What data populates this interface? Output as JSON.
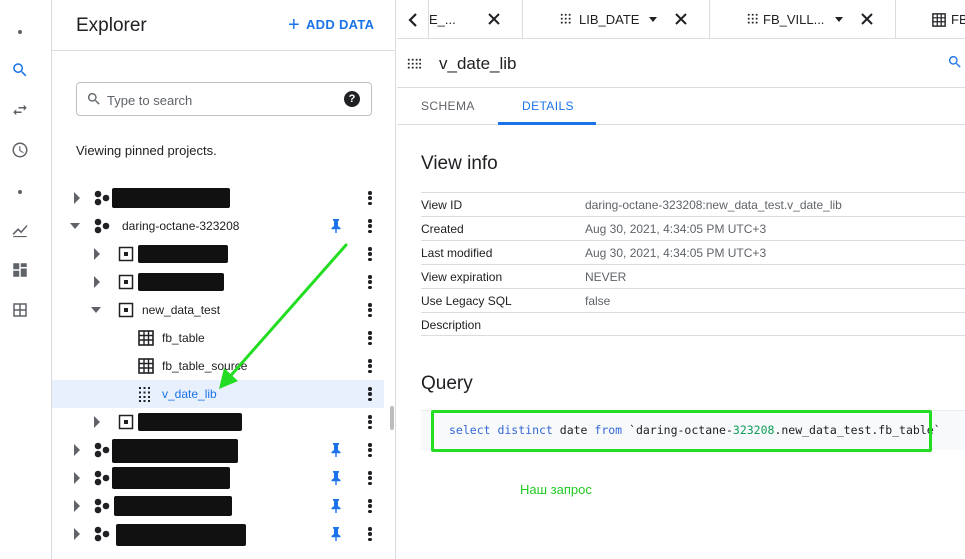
{
  "explorer": {
    "title": "Explorer",
    "add_data_label": "ADD DATA",
    "search_placeholder": "Type to search",
    "pinned_note": "Viewing pinned projects."
  },
  "tree": {
    "project_label": "daring-octane-323208",
    "dataset_label": "new_data_test",
    "items": [
      {
        "label": "fb_table"
      },
      {
        "label": "fb_table_source"
      },
      {
        "label": "v_date_lib"
      }
    ]
  },
  "tabs": [
    {
      "label": "E_...",
      "icon": "table-icon"
    },
    {
      "label": "LIB_DATE",
      "icon": "view-icon"
    },
    {
      "label": "FB_VILL...",
      "icon": "view-icon"
    },
    {
      "label": "FB",
      "icon": "table-icon"
    }
  ],
  "view": {
    "title": "v_date_lib",
    "subtabs": [
      "SCHEMA",
      "DETAILS"
    ],
    "active_subtab": "DETAILS",
    "info_heading": "View info",
    "info": [
      {
        "label": "View ID",
        "value": "daring-octane-323208:new_data_test.v_date_lib"
      },
      {
        "label": "Created",
        "value": "Aug 30, 2021, 4:34:05 PM UTC+3"
      },
      {
        "label": "Last modified",
        "value": "Aug 30, 2021, 4:34:05 PM UTC+3"
      },
      {
        "label": "View expiration",
        "value": "NEVER"
      },
      {
        "label": "Use Legacy SQL",
        "value": "false"
      },
      {
        "label": "Description",
        "value": ""
      }
    ],
    "query_heading": "Query",
    "query": {
      "k1": "select distinct",
      "t1": " date ",
      "k2": "from",
      "t2": " `daring-octane-",
      "n1": "323208",
      "t3": ".new_data_test.fb_table`"
    }
  },
  "annotation": {
    "note": "Наш запрос",
    "color": "#22dd22"
  },
  "colors": {
    "accent": "#1a73e8",
    "border": "#dadce0",
    "selected_row": "#e8f0fe"
  }
}
